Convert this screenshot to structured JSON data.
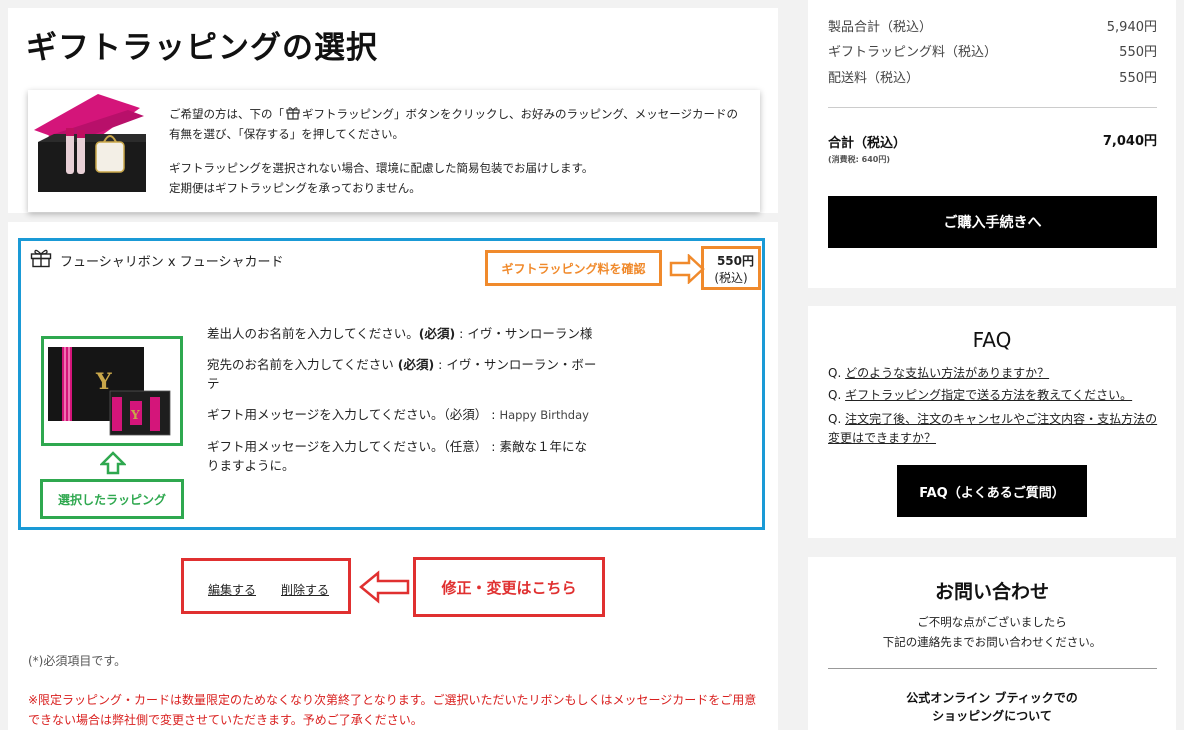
{
  "page": {
    "title": "ギフトラッピングの選択"
  },
  "intro": {
    "line1a": "ご希望の方は、下の「",
    "line1b": "ギフトラッピング」ボタンをクリックし、お好みのラッピング、メッセージカードの有無を選び、「保存する」を押してください。",
    "line2": "ギフトラッピングを選択されない場合、環境に配慮した簡易包装でお届けします。",
    "line3": "定期便はギフトラッピングを承っておりません。"
  },
  "wrapping": {
    "name": "フューシャリボン x フューシャカード",
    "price": "550円",
    "price_tax": "(税込)",
    "fields": [
      {
        "label": "差出人のお名前を入力してください。",
        "req": "(必須)",
        "sep": " : ",
        "value": "イヴ・サンローラン様"
      },
      {
        "label": "宛先のお名前を入力してください ",
        "req": "(必須)",
        "sep": " : ",
        "value": "イヴ・サンローラン・ボーテ"
      },
      {
        "label": "ギフト用メッセージを入力してください。（必須）",
        "req": "",
        "sep": " : ",
        "value": "Happy Birthday"
      },
      {
        "label": "ギフト用メッセージを入力してください。（任意）",
        "req": "",
        "sep": " : ",
        "value": "素敵な１年になりますように。"
      }
    ],
    "edit_label": "編集する",
    "delete_label": "削除する"
  },
  "annotations": {
    "price_check": "ギフトラッピング料を確認",
    "selected_wrap": "選択したラッピング",
    "edit_here": "修正・変更はこちら"
  },
  "notes": {
    "required": "(*)必須項目です。",
    "warning": "※限定ラッピング・カードは数量限定のためなくなり次第終了となります。ご選択いただいたリボンもしくはメッセージカードをご用意できない場合は弊社側で変更させていただきます。予めご了承ください。"
  },
  "summary": {
    "rows": [
      {
        "label": "製品合計（税込）",
        "value": "5,940円"
      },
      {
        "label": "ギフトラッピング料（税込）",
        "value": "550円"
      },
      {
        "label": "配送料（税込）",
        "value": "550円"
      }
    ],
    "total_label": "合計（税込）",
    "total_value": "7,040円",
    "tax_note": "(消費税: 640円)",
    "checkout_label": "ご購入手続きへ"
  },
  "faq": {
    "title": "FAQ",
    "questions": [
      "どのような支払い方法がありますか？",
      "ギフトラッピング指定で送る方法を教えてください。",
      "注文完了後、注文のキャンセルやご注文内容・支払方法の変更はできますか？"
    ],
    "q_prefix": "Q.",
    "button_label": "FAQ（よくあるご質問）"
  },
  "contact": {
    "title": "お問い合わせ",
    "sub1": "ご不明な点がございましたら",
    "sub2": "下記の連絡先までお問い合わせください。",
    "heading1": "公式オンライン ブティックでの",
    "heading2": "ショッピングについて"
  },
  "colors": {
    "blue": "#1a9ad6",
    "orange": "#f08a2c",
    "green": "#2fa84f",
    "red": "#e03030",
    "fuchsia": "#d4157a"
  }
}
